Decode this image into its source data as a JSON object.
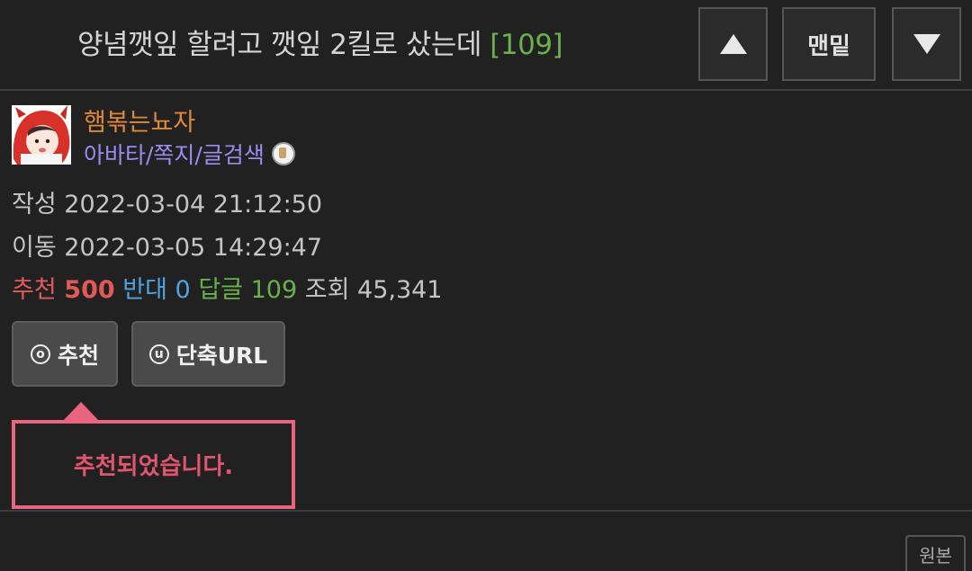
{
  "header": {
    "title": "양념깻잎 할려고 깻잎 2킬로 샀는데",
    "reply_count": "[109]",
    "up_icon": "triangle-up-icon",
    "bottom_label": "맨밑",
    "down_icon": "triangle-down-icon"
  },
  "author": {
    "nickname": "햄볶는뇨자",
    "links": "아바타/쪽지/글검색"
  },
  "meta": {
    "created_label": "작성",
    "created": "2022-03-04 21:12:50",
    "moved_label": "이동",
    "moved": "2022-03-05 14:29:47",
    "recommend_label": "추천",
    "recommend": "500",
    "oppose_label": "반대",
    "oppose": "0",
    "replies_label": "답글",
    "replies": "109",
    "views_label": "조회",
    "views": "45,341"
  },
  "actions": {
    "recommend_icon_letter": "o",
    "recommend_label": "추천",
    "shorturl_icon_letter": "u",
    "shorturl_label": "단축URL"
  },
  "tooltip": {
    "message": "추천되었습니다."
  },
  "footer": {
    "original_label": "원본"
  },
  "colors": {
    "background": "#212121",
    "nickname": "#e0893a",
    "links": "#9c8cf0",
    "recommend": "#e05a5a",
    "oppose": "#4fa3e0",
    "replies": "#6ab04c",
    "tooltip": "#e8647f"
  }
}
